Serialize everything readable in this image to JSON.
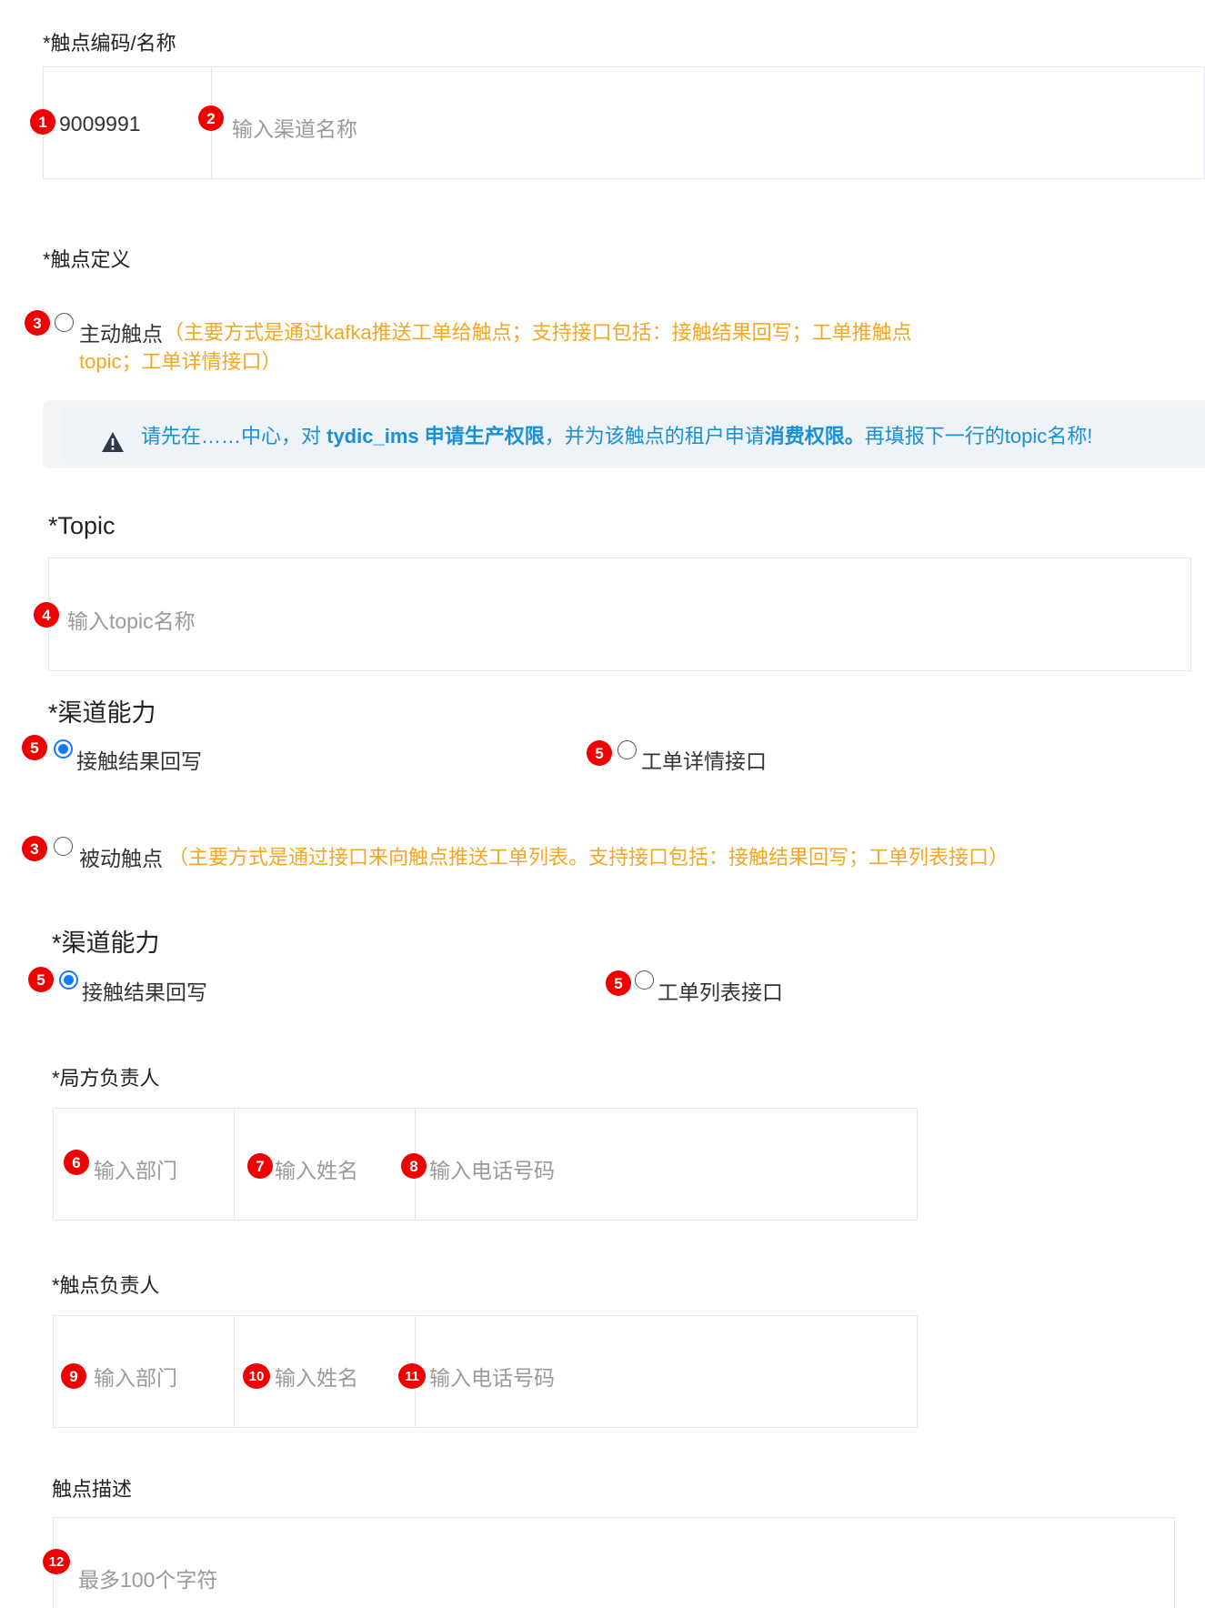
{
  "touchpoint_code_name": {
    "label": "*触点编码/名称",
    "code_value": "9009991",
    "name_placeholder": "输入渠道名称"
  },
  "touchpoint_definition": {
    "label": "*触点定义",
    "active": {
      "label": "主动触点",
      "desc_line1": "（主要方式是通过kafka推送工单给触点；支持接口包括：接触结果回写；工单推触点",
      "desc_line2": "topic；工单详情接口）",
      "selected": false
    },
    "alert": {
      "part1": "请先在……中心，对 ",
      "bold1": "tydic_ims 申请生产权限",
      "part2": "，并为该触点的租户申请",
      "bold2": "消费权限。",
      "part3": "再填报下一行的topic名称!"
    },
    "topic": {
      "label": "*Topic",
      "placeholder": "输入topic名称"
    },
    "active_capability": {
      "label": "*渠道能力",
      "opt1": {
        "label": "接触结果回写",
        "checked": true
      },
      "opt2": {
        "label": "工单详情接口",
        "checked": false
      }
    },
    "passive": {
      "label": "被动触点",
      "desc": "（主要方式是通过接口来向触点推送工单列表。支持接口包括：接触结果回写；工单列表接口）",
      "selected": false
    },
    "passive_capability": {
      "label": "*渠道能力",
      "opt1": {
        "label": "接触结果回写",
        "checked": true
      },
      "opt2": {
        "label": "工单列表接口",
        "checked": false
      }
    }
  },
  "bureau_owner": {
    "label": "*局方负责人",
    "dept_placeholder": "输入部门",
    "name_placeholder": "输入姓名",
    "phone_placeholder": "输入电话号码"
  },
  "touchpoint_owner": {
    "label": "*触点负责人",
    "dept_placeholder": "输入部门",
    "name_placeholder": "输入姓名",
    "phone_placeholder": "输入电话号码"
  },
  "description": {
    "label": "触点描述",
    "placeholder": "最多100个字符"
  },
  "badges": [
    "1",
    "2",
    "3",
    "4",
    "5",
    "6",
    "7",
    "8",
    "9",
    "10",
    "11",
    "12"
  ],
  "colors": {
    "badge": "#f00000",
    "accent": "#1677ff",
    "hint": "#f5a623",
    "alert_text": "#1a8fd8"
  }
}
